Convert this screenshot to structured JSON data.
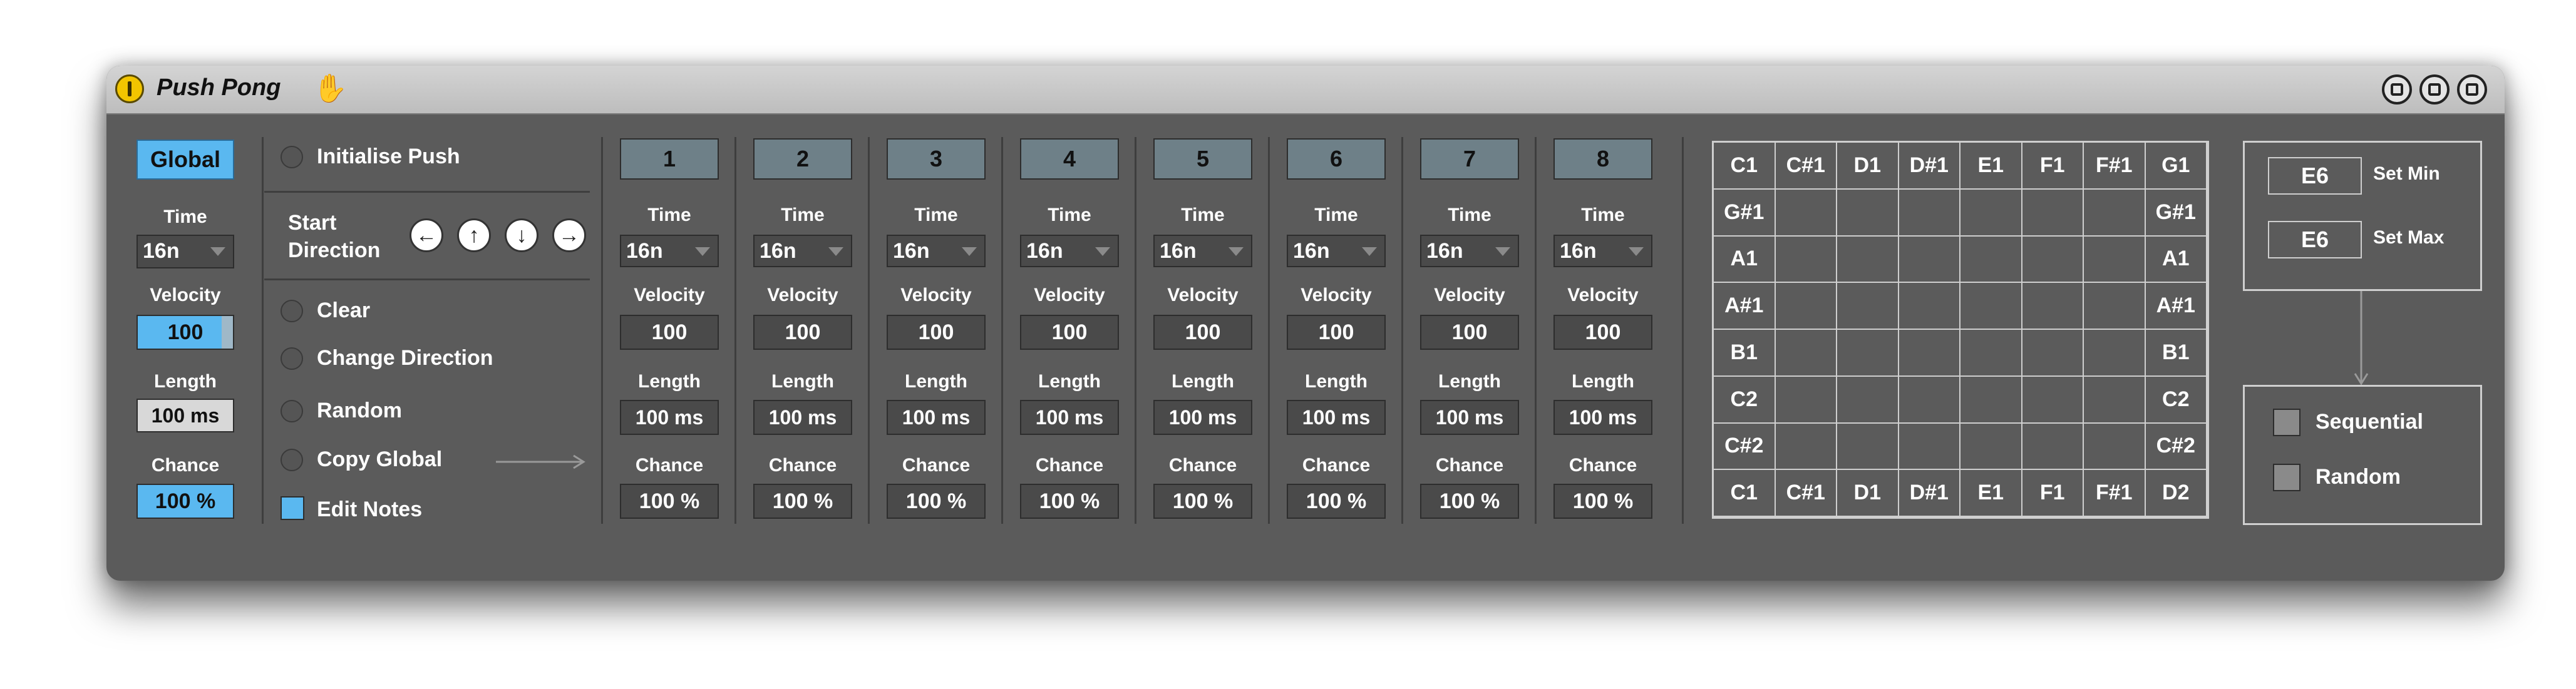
{
  "window": {
    "title": "Push Pong"
  },
  "global": {
    "button_label": "Global",
    "time_label": "Time",
    "time_value": "16n",
    "velocity_label": "Velocity",
    "velocity_value": "100",
    "length_label": "Length",
    "length_value": "100 ms",
    "chance_label": "Chance",
    "chance_value": "100 %"
  },
  "controls": {
    "initialise": "Initialise Push",
    "start_direction_line1": "Start",
    "start_direction_line2": "Direction",
    "clear": "Clear",
    "change_direction": "Change Direction",
    "random": "Random",
    "copy_global": "Copy Global",
    "edit_notes": "Edit Notes"
  },
  "channels": [
    {
      "number": "1",
      "time_label": "Time",
      "time": "16n",
      "velocity_label": "Velocity",
      "velocity": "100",
      "length_label": "Length",
      "length": "100 ms",
      "chance_label": "Chance",
      "chance": "100 %"
    },
    {
      "number": "2",
      "time_label": "Time",
      "time": "16n",
      "velocity_label": "Velocity",
      "velocity": "100",
      "length_label": "Length",
      "length": "100 ms",
      "chance_label": "Chance",
      "chance": "100 %"
    },
    {
      "number": "3",
      "time_label": "Time",
      "time": "16n",
      "velocity_label": "Velocity",
      "velocity": "100",
      "length_label": "Length",
      "length": "100 ms",
      "chance_label": "Chance",
      "chance": "100 %"
    },
    {
      "number": "4",
      "time_label": "Time",
      "time": "16n",
      "velocity_label": "Velocity",
      "velocity": "100",
      "length_label": "Length",
      "length": "100 ms",
      "chance_label": "Chance",
      "chance": "100 %"
    },
    {
      "number": "5",
      "time_label": "Time",
      "time": "16n",
      "velocity_label": "Velocity",
      "velocity": "100",
      "length_label": "Length",
      "length": "100 ms",
      "chance_label": "Chance",
      "chance": "100 %"
    },
    {
      "number": "6",
      "time_label": "Time",
      "time": "16n",
      "velocity_label": "Velocity",
      "velocity": "100",
      "length_label": "Length",
      "length": "100 ms",
      "chance_label": "Chance",
      "chance": "100 %"
    },
    {
      "number": "7",
      "time_label": "Time",
      "time": "16n",
      "velocity_label": "Velocity",
      "velocity": "100",
      "length_label": "Length",
      "length": "100 ms",
      "chance_label": "Chance",
      "chance": "100 %"
    },
    {
      "number": "8",
      "time_label": "Time",
      "time": "16n",
      "velocity_label": "Velocity",
      "velocity": "100",
      "length_label": "Length",
      "length": "100 ms",
      "chance_label": "Chance",
      "chance": "100 %"
    }
  ],
  "note_grid": {
    "top": [
      "C1",
      "C#1",
      "D1",
      "D#1",
      "E1",
      "F1",
      "F#1",
      "G1"
    ],
    "bottom": [
      "C1",
      "C#1",
      "D1",
      "D#1",
      "E1",
      "F1",
      "F#1",
      "D2"
    ],
    "left": [
      "G#1",
      "A1",
      "A#1",
      "B1",
      "C2",
      "C#2"
    ],
    "right": [
      "G#1",
      "A1",
      "A#1",
      "B1",
      "C2",
      "C#2"
    ]
  },
  "range": {
    "min_value": "E6",
    "min_label": "Set Min",
    "max_value": "E6",
    "max_label": "Set Max",
    "sequential": "Sequential",
    "random": "Random"
  },
  "colors": {
    "accent": "#5ab8f0",
    "panel": "#5b5b5b",
    "channel_button": "#6e8088"
  }
}
